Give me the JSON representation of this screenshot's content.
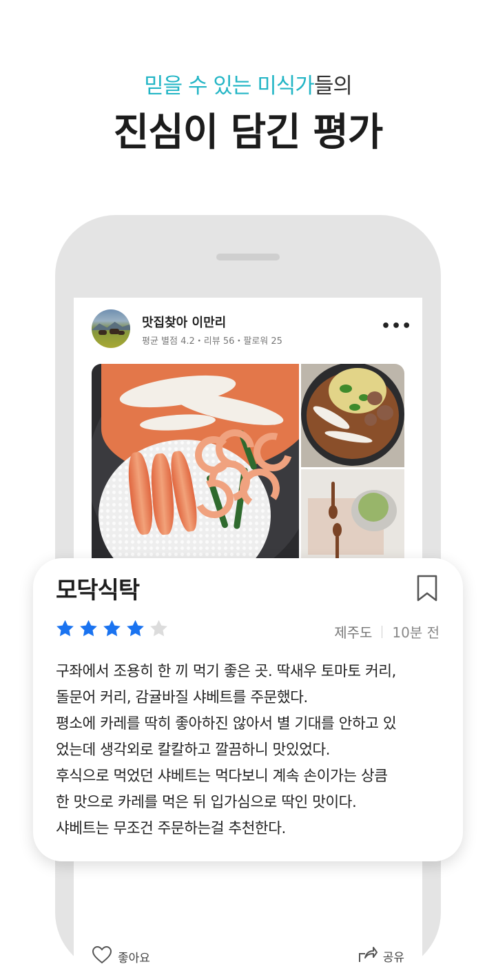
{
  "headline": {
    "sub_highlight": "믿을 수 있는 미식가",
    "sub_rest": "들의",
    "title": "진심이 담긴 평가"
  },
  "post": {
    "user_name": "맛집찾아 이만리",
    "user_stats": "평균 별점 4.2・리뷰 56・팔로워 25",
    "more_label": "•••",
    "like_label": "좋아요",
    "share_label": "공유"
  },
  "review_card": {
    "restaurant": "모닥식탁",
    "rating": 4,
    "max_rating": 5,
    "location": "제주도",
    "time": "10분 전",
    "text_lines": [
      "구좌에서 조용히 한 끼 먹기 좋은 곳. 딱새우 토마토 커리,",
      "돌문어 커리, 감귤바질 샤베트를 주문했다.",
      "평소에 카레를 딱히 좋아하진 않아서 별 기대를 안하고 있",
      "었는데 생각외로 칼칼하고 깔끔하니 맛있었다.",
      "후식으로 먹었던 샤베트는 먹다보니 계속 손이가는 상큼",
      "한 맛으로 카레를 먹은 뒤 입가심으로 딱인 맛이다.",
      "샤베트는 무조건 주문하는걸 추천한다."
    ]
  },
  "colors": {
    "accent_teal": "#22b5c5",
    "star_filled": "#1a73f0",
    "star_empty": "#dcdcdc"
  },
  "icons": [
    "more-icon",
    "bookmark-icon",
    "star-icon",
    "heart-icon",
    "share-icon"
  ]
}
